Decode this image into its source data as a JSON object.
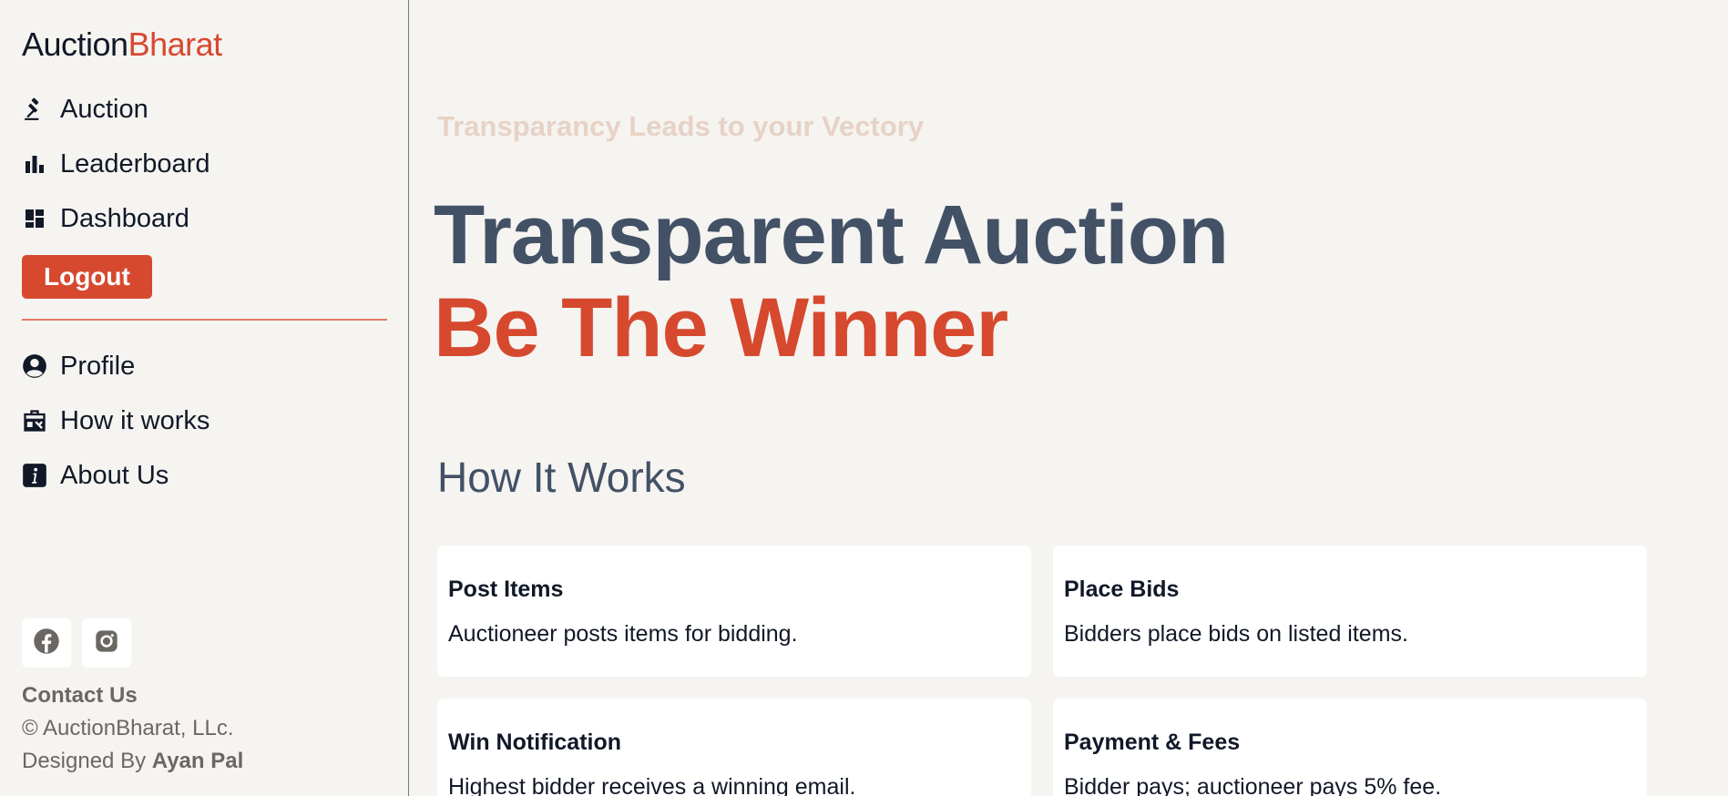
{
  "brand": {
    "name_main": "Auction",
    "name_accent": "Bharat",
    "accent_color": "#d6492f"
  },
  "nav_top": [
    {
      "label": "Auction",
      "icon": "gavel-icon"
    },
    {
      "label": "Leaderboard",
      "icon": "bar-chart-icon"
    },
    {
      "label": "Dashboard",
      "icon": "dashboard-icon"
    }
  ],
  "logout_label": "Logout",
  "nav_bottom": [
    {
      "label": "Profile",
      "icon": "user-circle-icon"
    },
    {
      "label": "How it works",
      "icon": "toolbox-icon"
    },
    {
      "label": "About Us",
      "icon": "info-icon"
    }
  ],
  "social": [
    "facebook-icon",
    "instagram-icon"
  ],
  "footer": {
    "contact": "Contact Us",
    "copyright": "© AuctionBharat, LLc.",
    "designed_prefix": "Designed By",
    "designer": "Ayan Pal"
  },
  "hero": {
    "tagline": "Transparancy Leads to your Vectory",
    "line1": "Transparent Auction",
    "line2": "Be The Winner"
  },
  "how_it_works": {
    "title": "How It Works",
    "cards": [
      {
        "title": "Post Items",
        "desc": "Auctioneer posts items for bidding."
      },
      {
        "title": "Place Bids",
        "desc": "Bidders place bids on listed items."
      },
      {
        "title": "Win Notification",
        "desc": "Highest bidder receives a winning email."
      },
      {
        "title": "Payment & Fees",
        "desc": "Bidder pays; auctioneer pays 5% fee."
      }
    ]
  }
}
